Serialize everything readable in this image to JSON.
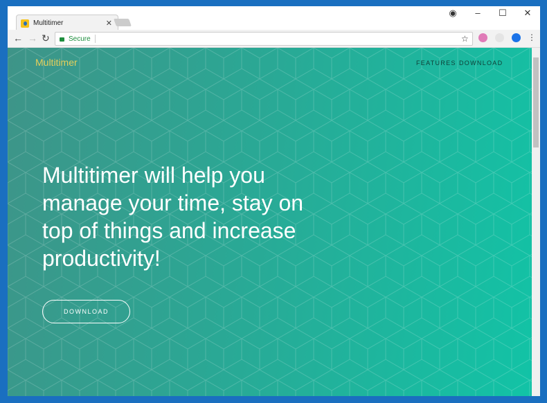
{
  "browser": {
    "tab_title": "Multitimer",
    "address_security": "Secure",
    "address_value": ""
  },
  "site": {
    "logo": "Multitimer",
    "nav": [
      "FEATURES",
      "DOWNLOAD"
    ],
    "headline": "Multitimer will help you manage your time, stay on top of things and increase productivity!",
    "download_button": "DOWNLOAD"
  },
  "colors": {
    "logo": "#e5cf5b",
    "secure": "#1e8e3e",
    "frame": "#1a6fc0"
  }
}
